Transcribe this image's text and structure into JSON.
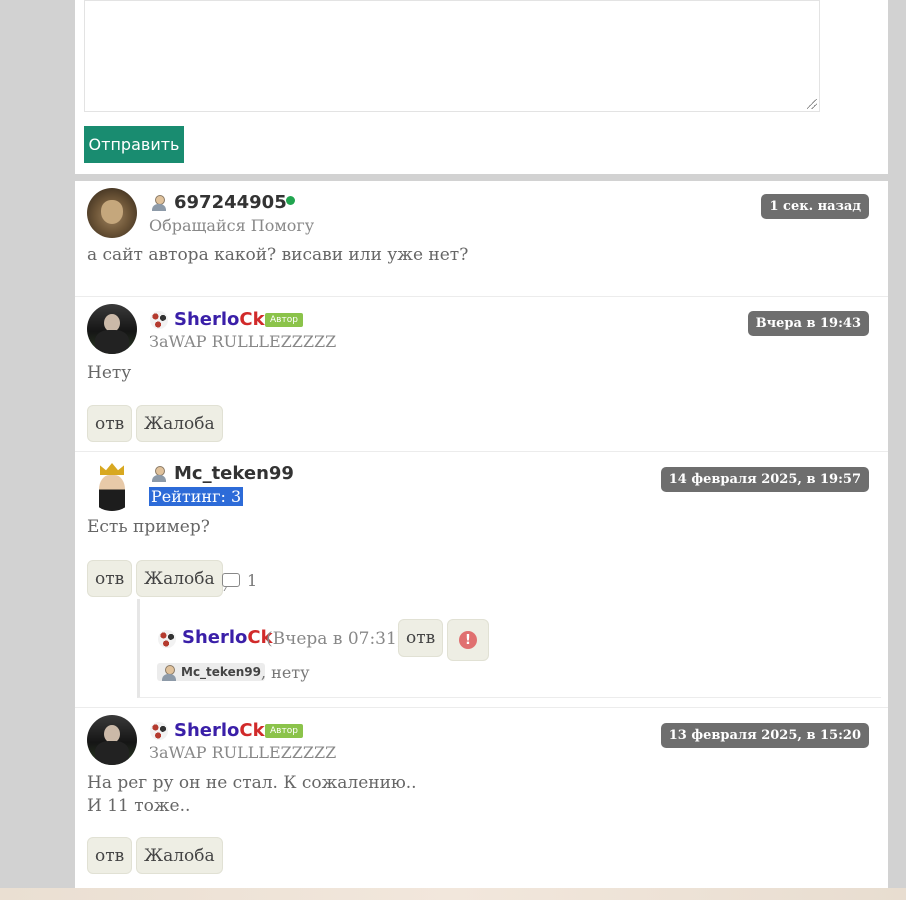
{
  "form": {
    "send_label": "Отправить"
  },
  "posts": [
    {
      "username": "697244905",
      "status": "Обращайся Помогу",
      "time": "1 сек. назад",
      "text": "а сайт автора какой? висави или уже нет?"
    },
    {
      "username_part1": "Sherlo",
      "username_part2": "Ck",
      "badge": "Автор",
      "status": "ЗаWAP RULLLEZZZZZ",
      "time": "Вчера в 19:43",
      "text": "Нету",
      "reply_label": "отв",
      "complain_label": "Жалоба"
    },
    {
      "username": "Mc_teken99",
      "status": "Рейтинг: 3",
      "time": "14 февраля 2025, в 19:57",
      "text": "Есть пример?",
      "reply_label": "отв",
      "complain_label": "Жалоба",
      "reply_count": "1",
      "reply": {
        "username_part1": "Sherlo",
        "username_part2": "Ck",
        "time": "(Вчера в 07:31)",
        "reply_label": "отв",
        "warn_icon": "!",
        "mention": "Mc_teken99",
        "text": ", нету"
      }
    },
    {
      "username_part1": "Sherlo",
      "username_part2": "Ck",
      "badge": "Автор",
      "status": "ЗаWAP RULLLEZZZZZ",
      "time": "13 февраля 2025, в 15:20",
      "text_line1": "На рег ру он не стал. К сожалению..",
      "text_line2": "И 11 тоже..",
      "reply_label": "отв",
      "complain_label": "Жалоба"
    }
  ]
}
